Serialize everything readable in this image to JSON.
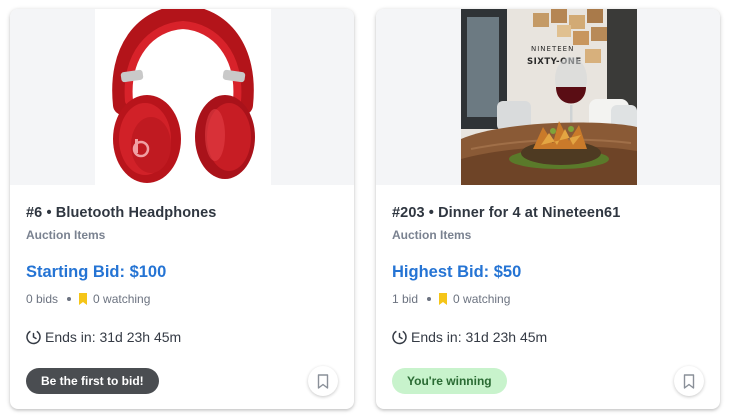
{
  "colors": {
    "accent_blue": "#2574d4",
    "watch_yellow": "#f5c518",
    "badge_dark": "#4a4d51",
    "badge_green": "#c8f3cc",
    "badge_green_text": "#2a6b33"
  },
  "cards": [
    {
      "image_icon": "red-over-ear-headphones",
      "title": "#6 • Bluetooth Headphones",
      "category": "Auction Items",
      "bid_label": "Starting Bid: $100",
      "bids": "0 bids",
      "watching": "0 watching",
      "watch_icon": "bookmark-filled-icon",
      "ends_icon": "timer-icon",
      "ends": "Ends in: 31d 23h 45m",
      "badge": "Be the first to bid!",
      "bookmark_icon": "bookmark-outline-icon"
    },
    {
      "image_icon": "restaurant-dinner-photo",
      "sign_text": [
        "NINETEEN",
        "SIXTY-ONE"
      ],
      "title": "#203 • Dinner for 4 at Nineteen61",
      "category": "Auction Items",
      "bid_label": "Highest Bid: $50",
      "bids": "1 bid",
      "watching": "0 watching",
      "watch_icon": "bookmark-filled-icon",
      "ends_icon": "timer-icon",
      "ends": "Ends in: 31d 23h 45m",
      "badge": "You're winning",
      "bookmark_icon": "bookmark-outline-icon"
    }
  ]
}
